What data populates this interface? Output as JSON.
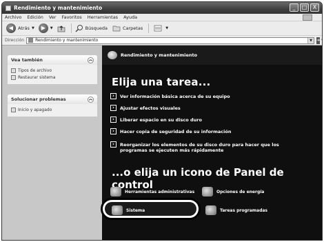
{
  "window": {
    "title": "Rendimiento y mantenimiento",
    "buttons": [
      "_",
      "□",
      "X"
    ]
  },
  "menubar": {
    "items": [
      "Archivo",
      "Edición",
      "Ver",
      "Favoritos",
      "Herramientas",
      "Ayuda"
    ]
  },
  "toolbar": {
    "back_label": "Atrás",
    "search_label": "Búsqueda",
    "folders_label": "Carpetas"
  },
  "address": {
    "label": "Dirección",
    "value": "Rendimiento y mantenimiento",
    "go_label": "Ir"
  },
  "sidebar": {
    "see_also": {
      "title": "Vea también",
      "items": [
        "Tipos de archivo",
        "Restaurar sistema"
      ]
    },
    "troubleshoot": {
      "title": "Solucionar problemas",
      "items": [
        "Inicio y apagado"
      ]
    }
  },
  "content": {
    "header_title": "Rendimiento y mantenimiento",
    "pick_task": "Elija una tarea...",
    "tasks": [
      "Ver información básica acerca de su equipo",
      "Ajustar efectos visuales",
      "Liberar espacio en su disco duro",
      "Hacer copia de seguridad de su información",
      "Reorganizar los elementos de su disco duro para hacer que los programas se ejecuten más rápidamente"
    ],
    "pick_icon": "...o elija un icono de Panel de control",
    "icons": [
      "Herramientas administrativas",
      "Opciones de energía",
      "Sistema",
      "Tareas programadas"
    ]
  }
}
